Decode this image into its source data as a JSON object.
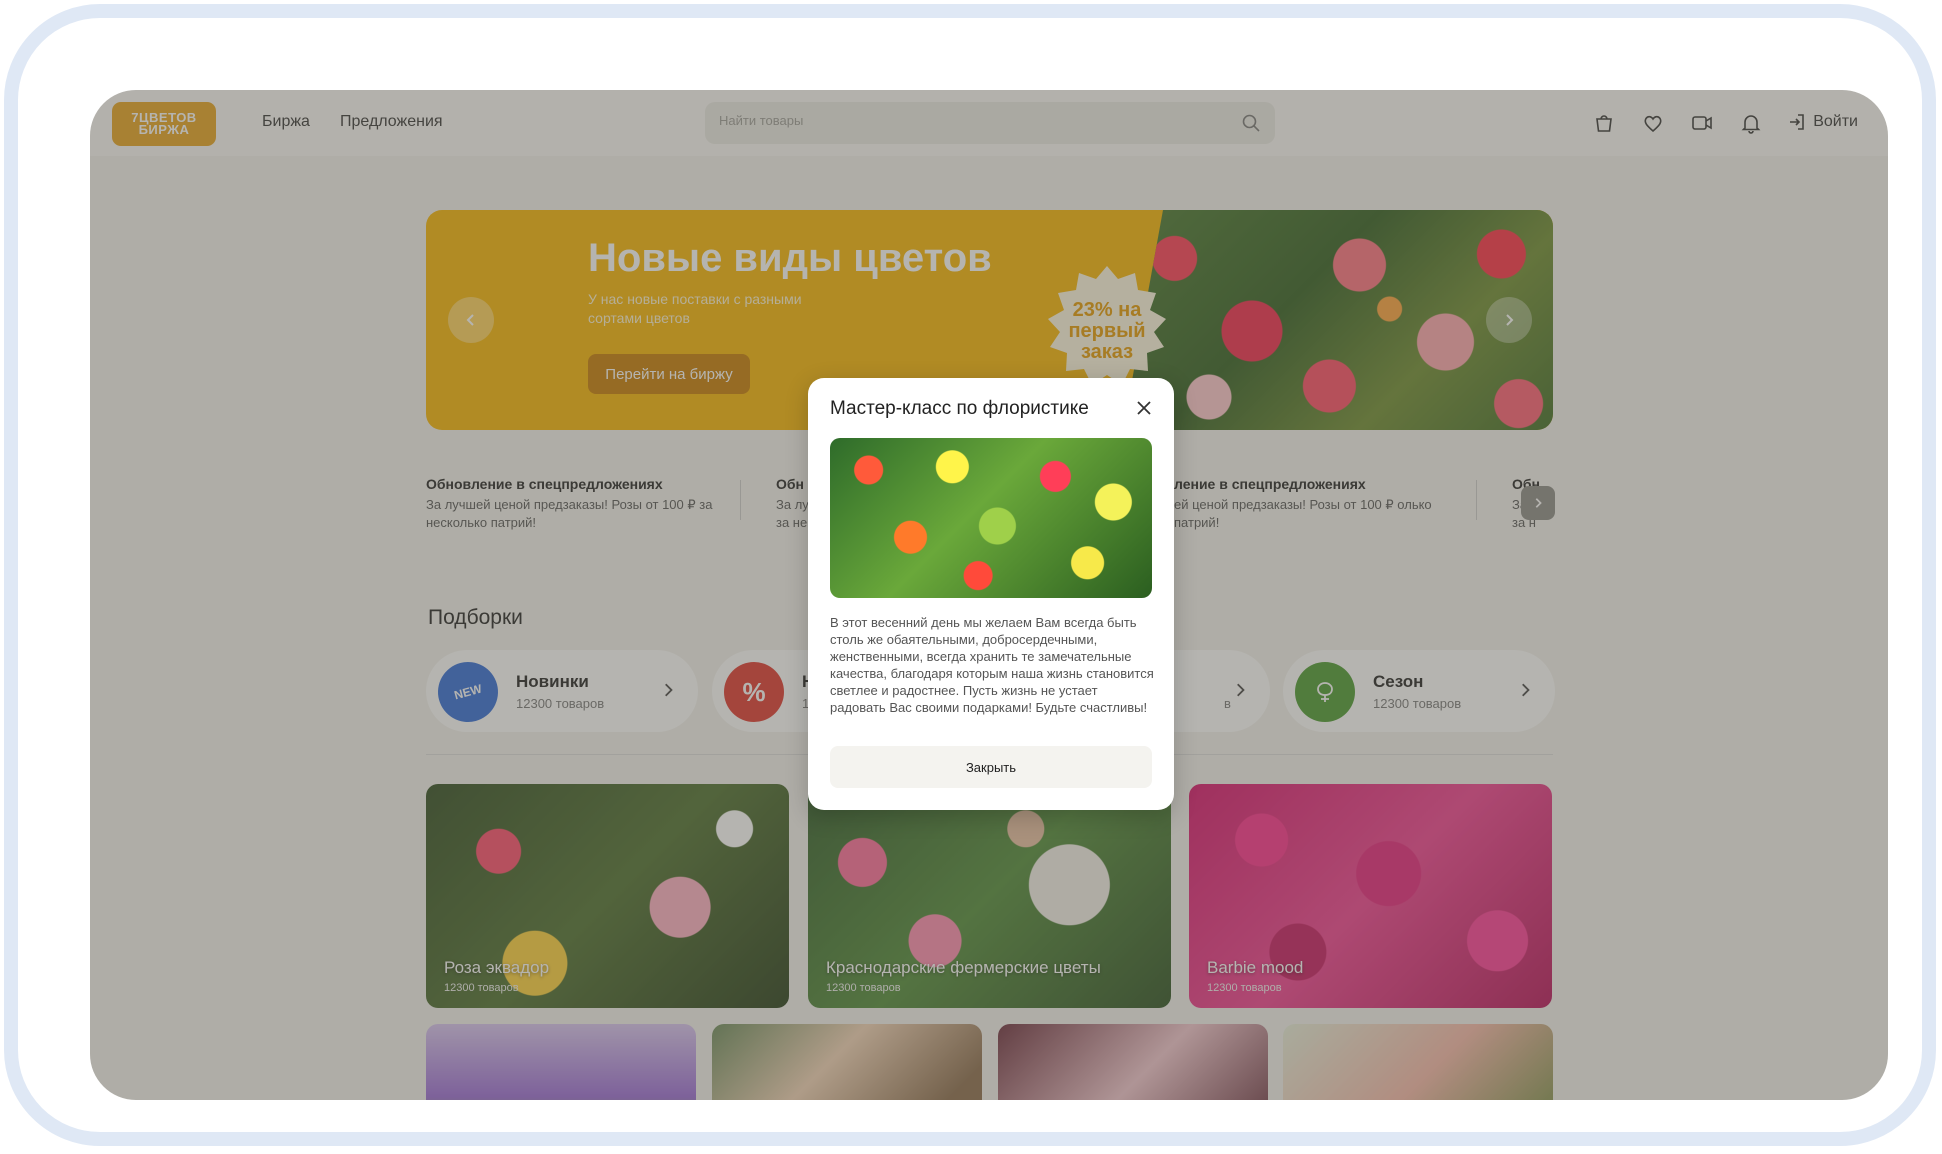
{
  "header": {
    "logo_line1": "7ЦВЕТОВ",
    "logo_line2": "БИРЖА",
    "nav": [
      "Биржа",
      "Предложения"
    ],
    "search_placeholder": "Найти товары",
    "login": "Войти",
    "icons": [
      "bag-icon",
      "heart-icon",
      "video-icon",
      "bell-icon",
      "login-icon"
    ]
  },
  "banner": {
    "title": "Новые виды цветов",
    "subtitle": "У нас новые поставки с разными сортами цветов",
    "button": "Перейти на биржу",
    "badge": [
      "23% на",
      "первый",
      "заказ"
    ]
  },
  "news": [
    {
      "title": "Обновление в спецпредложениях",
      "desc": "За лучшей ценой предзаказы! Розы от 100 ₽ за несколько патрий!"
    },
    {
      "title": "Обн",
      "desc": "За лу за не"
    },
    {
      "title": "ление в спецпредложениях",
      "desc": "ей ценой предзаказы! Розы от 100 ₽ олько патрий!"
    },
    {
      "title": "Обн",
      "desc": "За л за н"
    }
  ],
  "section_title": "Подборки",
  "collections": [
    {
      "badge": "NEW",
      "name": "Новинки",
      "count": "12300 товаров",
      "color": "#2f6bd8"
    },
    {
      "badge": "%",
      "name": "Н",
      "count": "1",
      "color": "#e0362c"
    },
    {
      "badge": "",
      "name": "",
      "count": "в",
      "color": "#ffffff"
    },
    {
      "badge": "",
      "name": "Сезон",
      "count": "12300 товаров",
      "color": "#4a9a2e"
    }
  ],
  "cards": [
    {
      "name": "Роза эквадор",
      "count": "12300 товаров"
    },
    {
      "name": "Краснодарские фермерские цветы",
      "count": "12300 товаров"
    },
    {
      "name": "Barbie mood",
      "count": "12300 товаров"
    }
  ],
  "modal": {
    "title": "Мастер-класс по флористике",
    "text": "В этот весенний день мы желаем Вам всегда быть столь же обаятельными, добросердечными, женственными, всегда хранить те замечательные качества, благодаря которым наша жизнь становится светлее и радостнее. Пусть жизнь не устает радовать Вас своими подарками! Будьте счастливы!",
    "button": "Закрыть"
  },
  "colors": {
    "accent": "#f7b500",
    "overlay": "rgba(90,88,80,0.45)"
  }
}
